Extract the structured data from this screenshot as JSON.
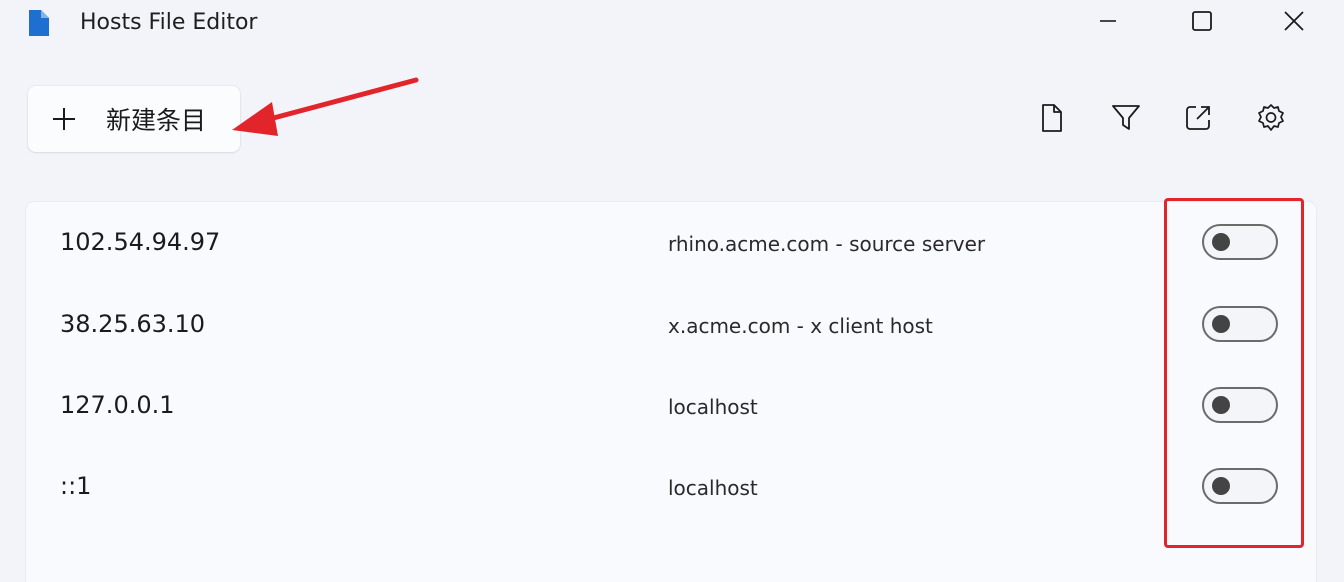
{
  "window": {
    "title": "Hosts File Editor",
    "app_icon": "document-icon"
  },
  "titlebar_buttons": [
    "minimize-icon",
    "maximize-icon",
    "close-icon"
  ],
  "toolbar": {
    "new_entry_label": "新建条目",
    "new_entry_icon": "plus-icon",
    "icons": [
      "file-icon",
      "filter-icon",
      "open-external-icon",
      "gear-icon"
    ]
  },
  "entries": [
    {
      "address": "102.54.94.97",
      "hosts": "rhino.acme.com - source server",
      "enabled": false
    },
    {
      "address": "38.25.63.10",
      "hosts": "x.acme.com - x client host",
      "enabled": false
    },
    {
      "address": "127.0.0.1",
      "hosts": "localhost",
      "enabled": false
    },
    {
      "address": "::1",
      "hosts": "localhost",
      "enabled": false
    }
  ],
  "colors": {
    "accent_blue": "#1e6fd0",
    "annotation_red": "#e2252b",
    "background": "#f2f4f9"
  }
}
